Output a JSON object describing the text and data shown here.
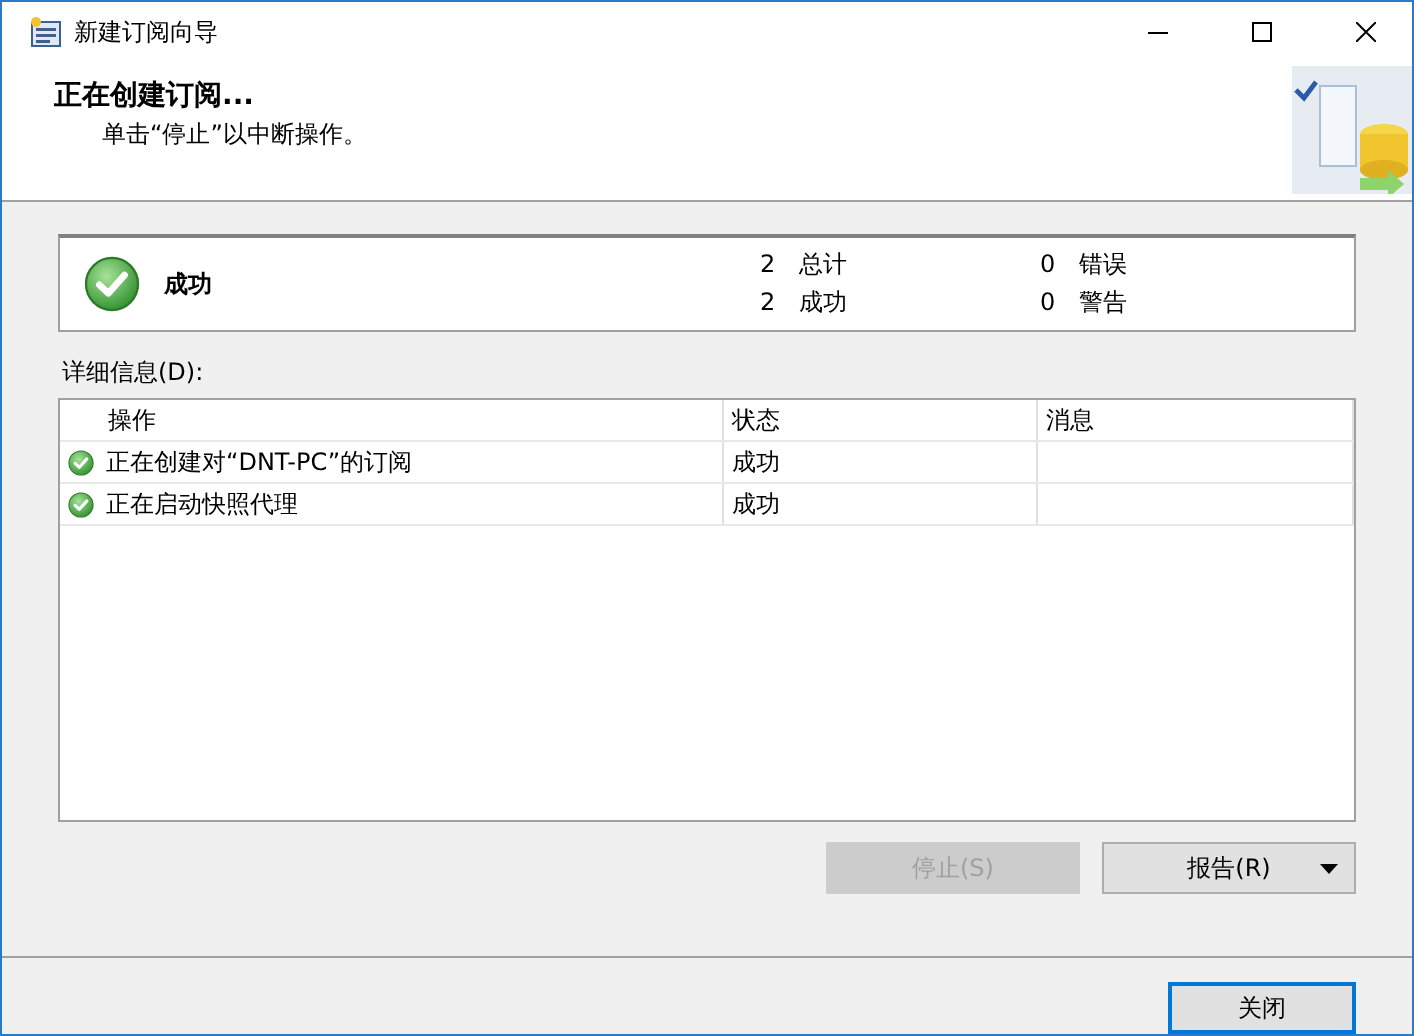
{
  "window": {
    "title": "新建订阅向导"
  },
  "header": {
    "title": "正在创建订阅...",
    "subtitle": "单击“停止”以中断操作。"
  },
  "summary": {
    "status": "成功",
    "stats": [
      "2 总计",
      "2 成功",
      "0 错误",
      "0 警告"
    ]
  },
  "details_label": "详细信息(D):",
  "table": {
    "columns": [
      "操作",
      "状态",
      "消息"
    ],
    "rows": [
      {
        "action": "正在创建对“DNT-PC”的订阅",
        "status": "成功",
        "message": ""
      },
      {
        "action": "正在启动快照代理",
        "status": "成功",
        "message": ""
      }
    ]
  },
  "buttons": [
    {
      "label": "停止(S)",
      "disabled": true,
      "dropdown": false
    },
    {
      "label": "报告(R)",
      "disabled": false,
      "dropdown": true
    }
  ],
  "close_button": {
    "label": "关闭",
    "focused": true
  }
}
